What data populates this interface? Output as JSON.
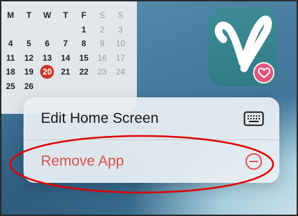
{
  "calendar": {
    "weekday_headers": [
      "M",
      "T",
      "W",
      "T",
      "F",
      "S",
      "S"
    ],
    "rows": [
      [
        "",
        "",
        "",
        "",
        "1",
        "2",
        "3"
      ],
      [
        "4",
        "5",
        "6",
        "7",
        "8",
        "9",
        "10"
      ],
      [
        "11",
        "12",
        "13",
        "14",
        "15",
        "16",
        "17"
      ],
      [
        "18",
        "19",
        "20",
        "21",
        "22",
        "23",
        "24"
      ],
      [
        "25",
        "26",
        "",
        "",
        "",
        "",
        ""
      ]
    ],
    "today": "20",
    "accent_color": "#c9352a"
  },
  "app_icon": {
    "logo_icon": "heart-check-icon",
    "badge_icon": "heart-badge-icon",
    "background_color": "#3f8c96",
    "badge_color": "#e0557f"
  },
  "context_menu": {
    "items": [
      {
        "label": "Edit Home Screen",
        "icon": "keyboard-icon"
      },
      {
        "label": "Remove App",
        "icon": "minus-circle-icon",
        "color": "#d9534a"
      }
    ]
  },
  "annotation": {
    "color": "#e00000"
  }
}
